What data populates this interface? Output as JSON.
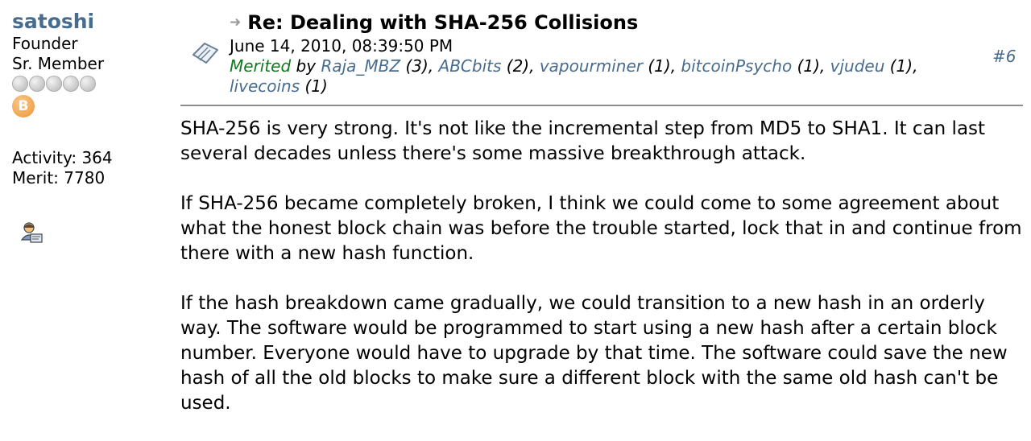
{
  "poster": {
    "username": "satoshi",
    "position": "Founder",
    "rank": "Sr. Member",
    "rank_dots": 5,
    "badge_symbol": "B",
    "activity_label": "Activity:",
    "activity_value": "364",
    "merit_label": "Merit:",
    "merit_value": "7780",
    "profile_icon": "user-profile-icon"
  },
  "post": {
    "subject": "Re: Dealing with SHA-256 Collisions",
    "date": "June 14, 2010, 08:39:50 PM",
    "merited_word": "Merited",
    "merited_by_word": "by",
    "merits": [
      {
        "user": "Raja_MBZ",
        "count": "(3)"
      },
      {
        "user": "ABCbits",
        "count": "(2)"
      },
      {
        "user": "vapourminer",
        "count": "(1)"
      },
      {
        "user": "bitcoinPsycho",
        "count": "(1)"
      },
      {
        "user": "vjudeu",
        "count": "(1)"
      },
      {
        "user": "livecoins",
        "count": "(1)"
      }
    ],
    "number": "#6",
    "paragraphs": [
      "SHA-256 is very strong.  It's not like the incremental step from MD5 to SHA1.  It can last several decades unless there's some massive breakthrough attack.",
      "If SHA-256 became completely broken, I think we could come to some agreement about what the honest block chain was before the trouble started, lock that in and continue from there with a new hash function.",
      "If the hash breakdown came gradually, we could transition to a new hash in an orderly way.  The software would be programmed to start using a new hash after a certain block number.  Everyone would have to upgrade by that time.  The software could save the new hash of all the old blocks to make sure a different block with the same old hash can't be used."
    ]
  },
  "colors": {
    "link": "#476c8e",
    "merited": "#0e7a1c",
    "badge": "#f0a44e"
  }
}
